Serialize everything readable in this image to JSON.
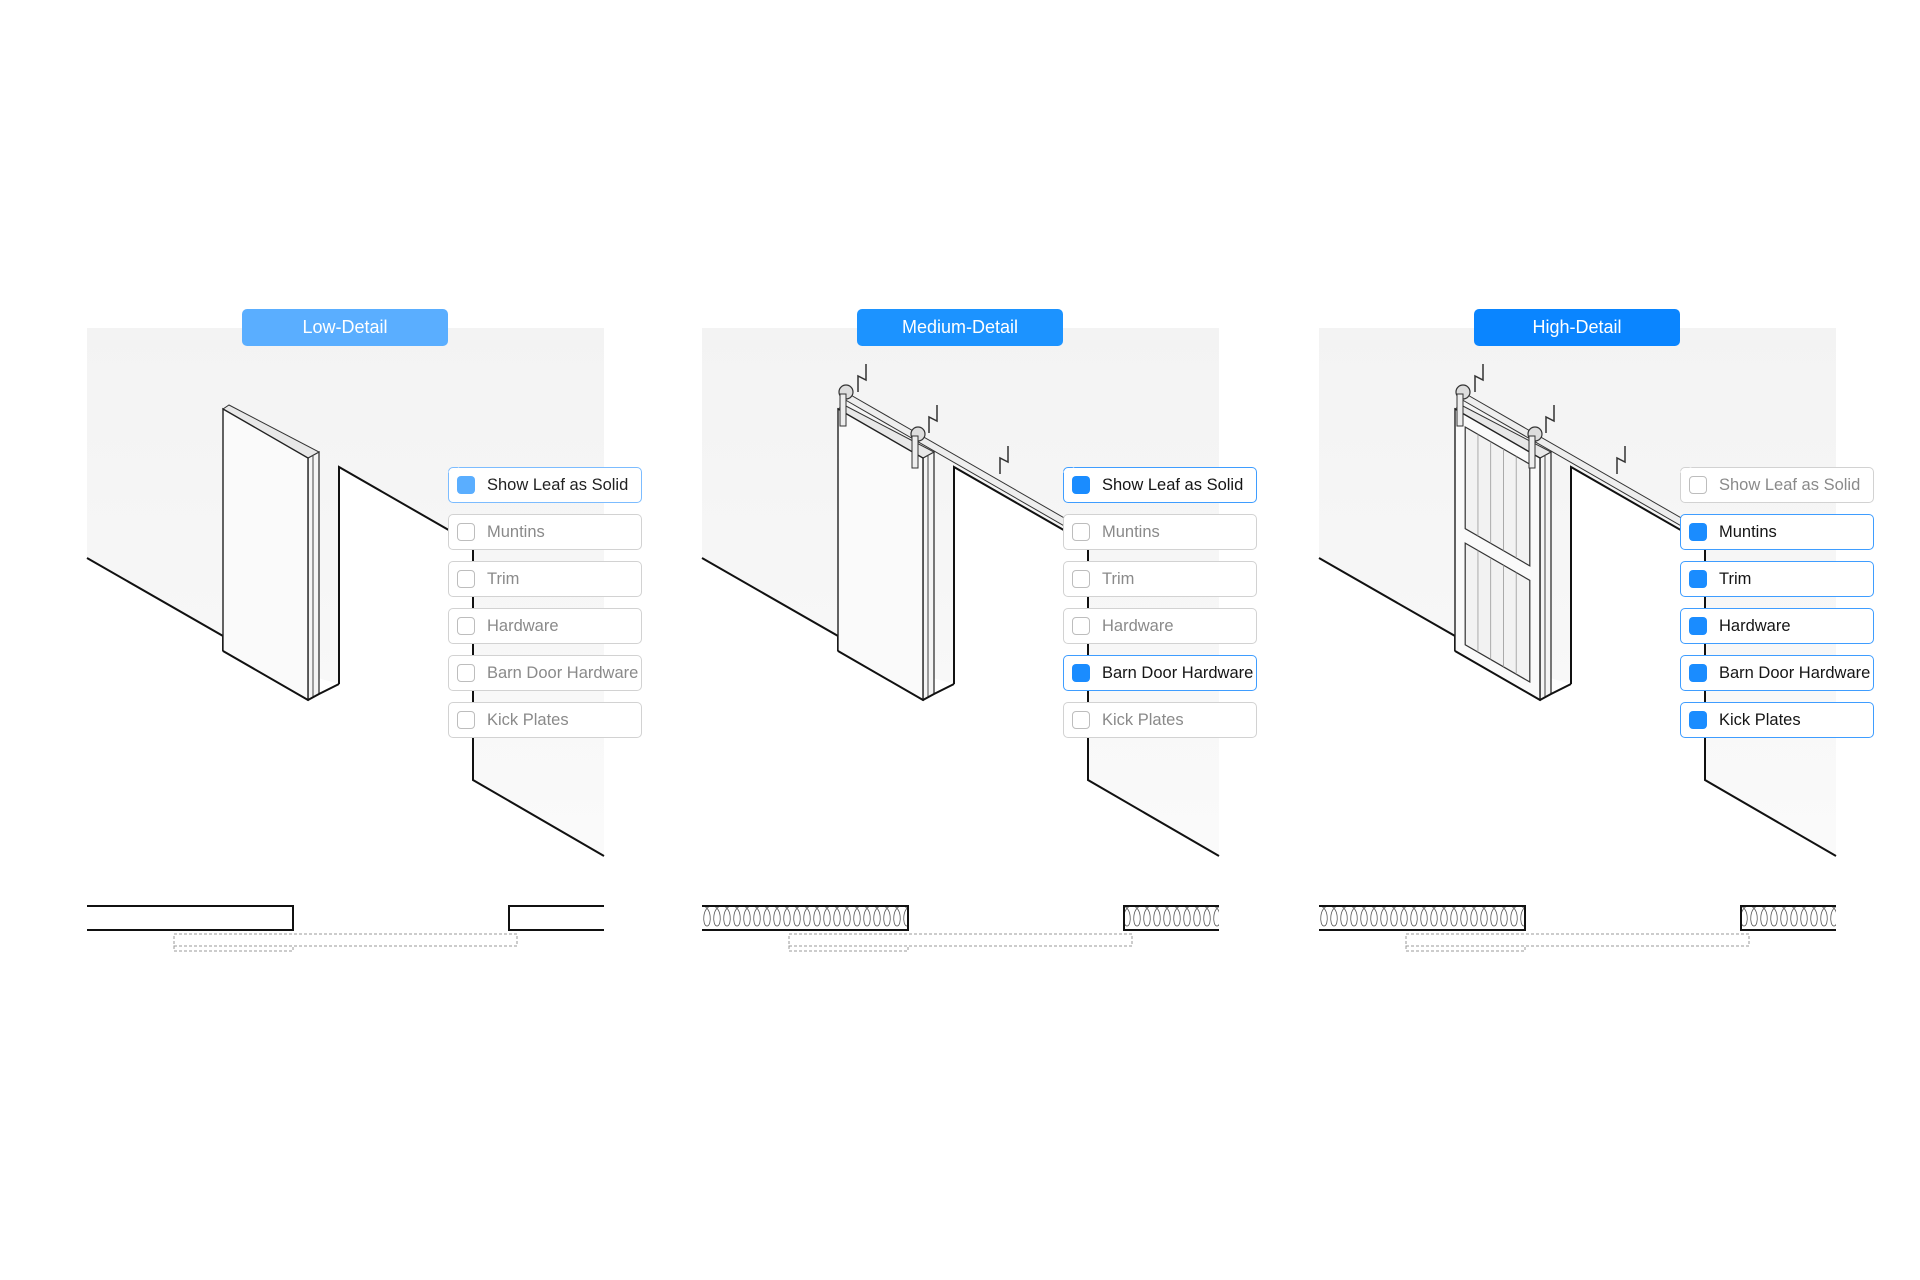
{
  "colors": {
    "low": "#5aaeff",
    "medium": "#1c93ff",
    "high": "#0a85ff",
    "checkbox_low": "#5aaeff",
    "checkbox": "#1a8cff"
  },
  "panels": [
    {
      "title": "Low-Detail",
      "level": "low",
      "options": [
        {
          "label": "Show Leaf as Solid",
          "checked": true
        },
        {
          "label": "Muntins",
          "checked": false
        },
        {
          "label": "Trim",
          "checked": false
        },
        {
          "label": "Hardware",
          "checked": false
        },
        {
          "label": "Barn Door Hardware",
          "checked": false
        },
        {
          "label": "Kick Plates",
          "checked": false
        }
      ]
    },
    {
      "title": "Medium-Detail",
      "level": "medium",
      "options": [
        {
          "label": "Show Leaf as Solid",
          "checked": true
        },
        {
          "label": "Muntins",
          "checked": false
        },
        {
          "label": "Trim",
          "checked": false
        },
        {
          "label": "Hardware",
          "checked": false
        },
        {
          "label": "Barn Door Hardware",
          "checked": true
        },
        {
          "label": "Kick Plates",
          "checked": false
        }
      ]
    },
    {
      "title": "High-Detail",
      "level": "high",
      "options": [
        {
          "label": "Show Leaf as Solid",
          "checked": false
        },
        {
          "label": "Muntins",
          "checked": true
        },
        {
          "label": "Trim",
          "checked": true
        },
        {
          "label": "Hardware",
          "checked": true
        },
        {
          "label": "Barn Door Hardware",
          "checked": true
        },
        {
          "label": "Kick Plates",
          "checked": true
        }
      ]
    }
  ]
}
